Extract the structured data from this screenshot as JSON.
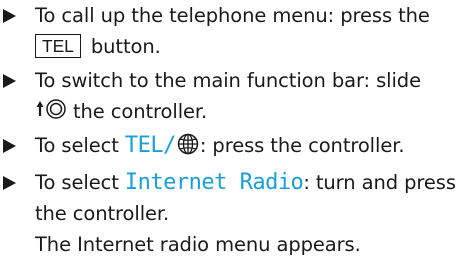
{
  "steps": [
    {
      "line1": "To call up the telephone menu: press the",
      "key": "TEL",
      "after": " button."
    },
    {
      "line1": "To switch to the main function bar: slide",
      "after": "the controller."
    },
    {
      "before": "To select ",
      "highlight": "TEL/",
      "after": ": press the controller."
    },
    {
      "before": "To select ",
      "highlight": "Internet Radio",
      "after1": ": turn and press",
      "line2": "the controller.",
      "result": "The Internet radio menu appears."
    }
  ],
  "icons": {
    "bullet": "triangle-bullet-icon",
    "controller_slide": "slide-up-controller-icon",
    "globe": "globe-icon"
  },
  "colors": {
    "text": "#1a1a1a",
    "highlight": "#1c9fd6"
  }
}
